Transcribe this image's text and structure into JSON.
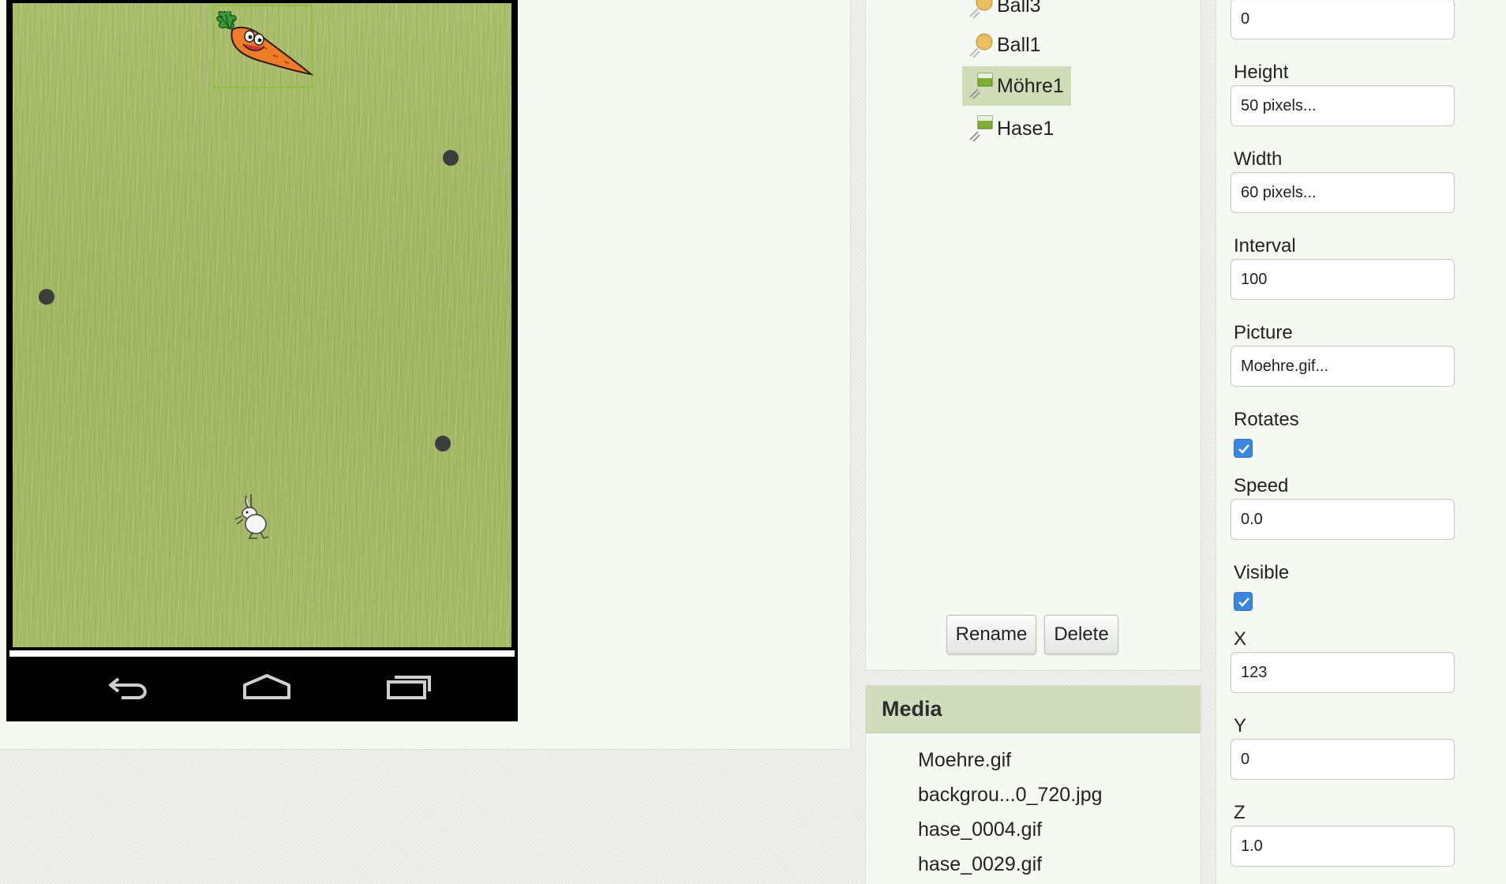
{
  "viewer": {
    "nav_buttons": [
      "back-icon",
      "home-icon",
      "recent-apps-icon"
    ]
  },
  "components": {
    "items": [
      {
        "label": "Ball3",
        "icon": "ball-icon"
      },
      {
        "label": "Ball1",
        "icon": "ball-icon"
      },
      {
        "label": "Möhre1",
        "icon": "imagesprite-icon",
        "selected": true
      },
      {
        "label": "Hase1",
        "icon": "imagesprite-icon"
      }
    ],
    "rename_label": "Rename",
    "delete_label": "Delete"
  },
  "media": {
    "title": "Media",
    "files": [
      "Moehre.gif",
      "backgrou...0_720.jpg",
      "hase_0004.gif",
      "hase_0029.gif"
    ]
  },
  "properties": {
    "top_value": "0",
    "height_label": "Height",
    "height_value": "50 pixels...",
    "width_label": "Width",
    "width_value": "60 pixels...",
    "interval_label": "Interval",
    "interval_value": "100",
    "picture_label": "Picture",
    "picture_value": "Moehre.gif...",
    "rotates_label": "Rotates",
    "rotates_checked": true,
    "speed_label": "Speed",
    "speed_value": "0.0",
    "visible_label": "Visible",
    "visible_checked": true,
    "x_label": "X",
    "x_value": "123",
    "y_label": "Y",
    "y_value": "0",
    "z_label": "Z",
    "z_value": "1.0"
  },
  "colors": {
    "canvas_green": "#a4b864",
    "selection_green": "#8fc13c",
    "media_header": "#d0dcbc",
    "checkbox_blue": "#3b87e0"
  }
}
